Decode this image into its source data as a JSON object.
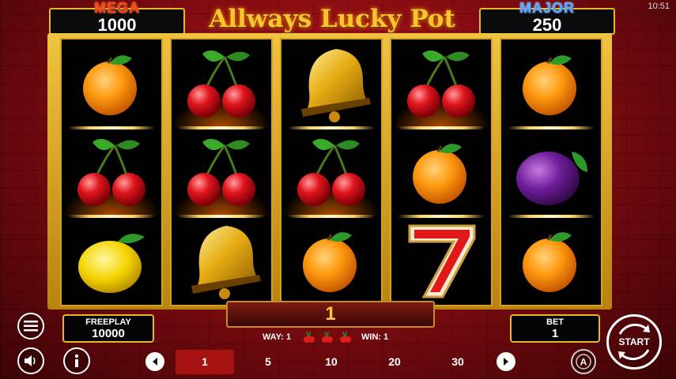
{
  "status": {
    "time": "10:51"
  },
  "game": {
    "title": "Allways Lucky Pot"
  },
  "jackpots": {
    "mega": {
      "label": "MEGA",
      "value": "1000"
    },
    "major": {
      "label": "MAJOR",
      "value": "250"
    }
  },
  "reels": [
    {
      "symbols": [
        "orange",
        "cherry",
        "lemon"
      ]
    },
    {
      "symbols": [
        "cherry",
        "cherry",
        "bell"
      ]
    },
    {
      "symbols": [
        "bell",
        "cherry",
        "orange"
      ]
    },
    {
      "symbols": [
        "cherry",
        "orange",
        "seven"
      ]
    },
    {
      "symbols": [
        "orange",
        "plum",
        "orange"
      ]
    }
  ],
  "win": {
    "value": "1",
    "way_label": "WAY: 1",
    "win_label": "WIN: 1"
  },
  "freeplay": {
    "label": "FREEPLAY",
    "value": "10000"
  },
  "bet": {
    "label": "BET",
    "value": "1",
    "options": [
      "1",
      "5",
      "10",
      "20",
      "30"
    ],
    "selected": "1"
  },
  "buttons": {
    "start_label": "START"
  },
  "icons": [
    "menu-icon",
    "sound-icon",
    "info-icon",
    "left-arrow-icon",
    "right-arrow-icon",
    "autoplay-icon",
    "start-icon"
  ]
}
